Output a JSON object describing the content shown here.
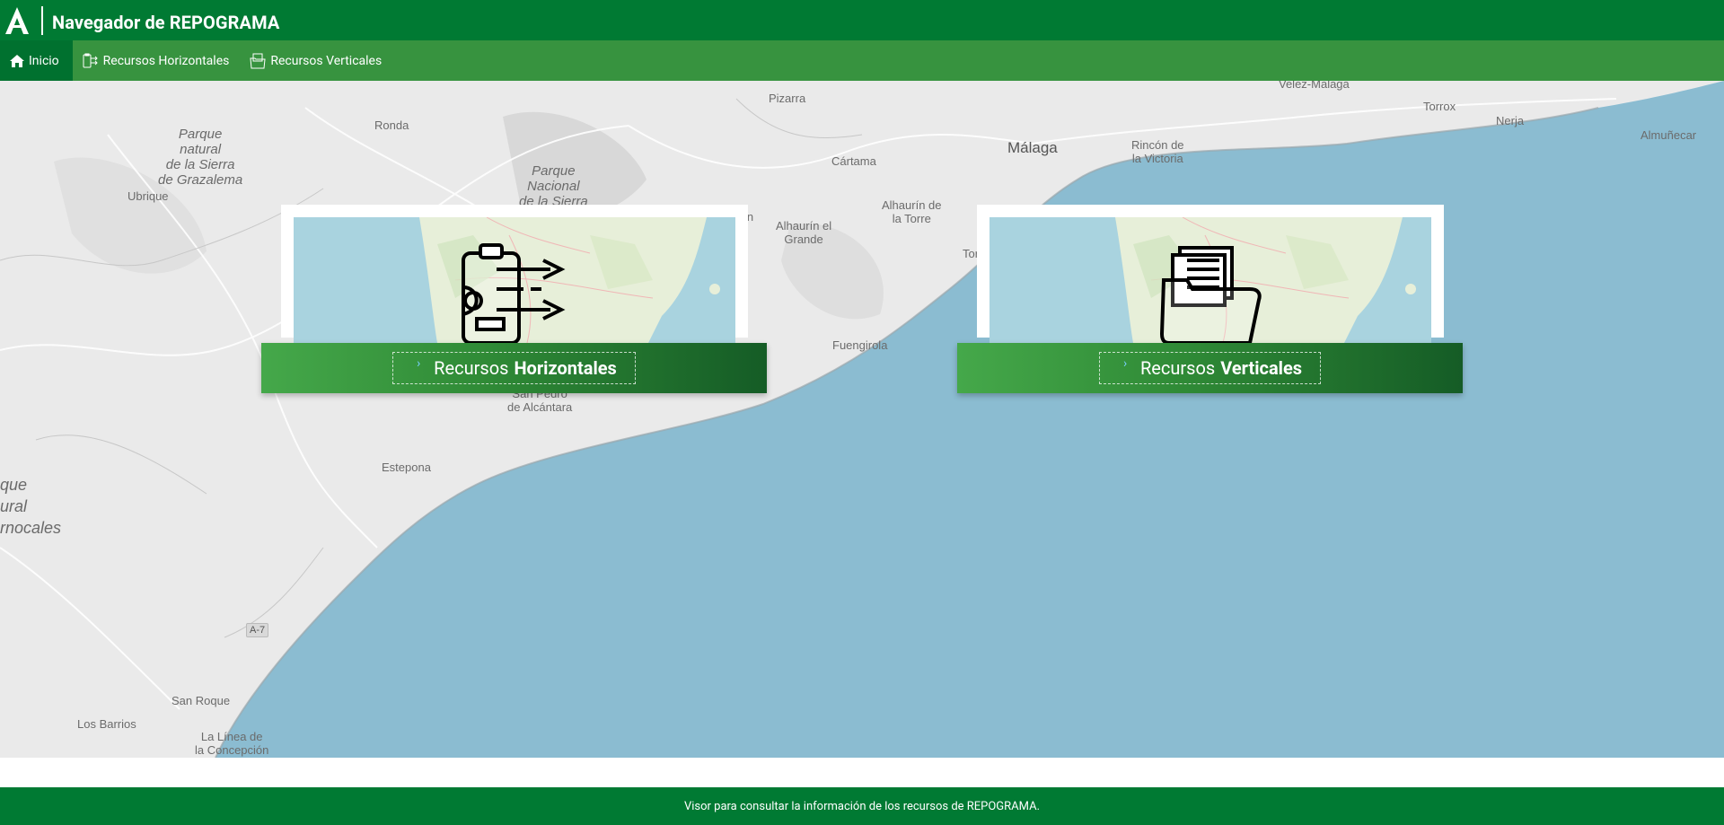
{
  "header": {
    "title": "Navegador de REPOGRAMA",
    "logo_icon": "junta-andalucia-logo-icon"
  },
  "nav": {
    "items": [
      {
        "label": "Inicio",
        "icon": "home-icon",
        "active": true
      },
      {
        "label": "Recursos Horizontales",
        "icon": "horizontal-resources-icon",
        "active": false
      },
      {
        "label": "Recursos Verticales",
        "icon": "vertical-resources-icon",
        "active": false
      }
    ]
  },
  "map": {
    "labels": {
      "velez": "Velez-Malaga",
      "torrox": "Torrox",
      "nerja": "Nerja",
      "almunecar": "Almuñecar",
      "pizarra": "Pizarra",
      "ronda": "Ronda",
      "malaga": "Málaga",
      "rincon": "Rincón de\nla Victoria",
      "cartama": "Cártama",
      "alhaurin_el": "Alhaurín el\nGrande",
      "alhaurin_torre": "Alhaurín de\nla Torre",
      "torremolinos": "Torrem",
      "fuengirola": "Fuengirola",
      "ubrique": "Ubrique",
      "parque_grazalema": "Parque\nnatural\nde la Sierra\nde Grazalema",
      "parque_nacional": "Parque\nNacional\nde la Sierra",
      "san_pedro": "San Pedro\nde Alcántara",
      "estepona": "Estepona",
      "parque_left": "que\nural\nrnocales",
      "a7": "A-7",
      "san_roque": "San Roque",
      "los_barrios": "Los Barrios",
      "la_linea": "La Línea de\nla Concepción",
      "in_fragment": "in"
    },
    "colors": {
      "land": "#eaeaea",
      "sea": "#8bbcd1",
      "coast": "#a0b8c4"
    }
  },
  "cards": [
    {
      "name": "horizontal",
      "label_regular": "Recursos",
      "label_bold": "Horizontales",
      "icon": "clipboard-gear-arrows-icon"
    },
    {
      "name": "vertical",
      "label_regular": "Recursos",
      "label_bold": "Verticales",
      "icon": "folder-documents-icon"
    }
  ],
  "footer": {
    "text": "Visor para consultar la información de los recursos de REPOGRAMA."
  }
}
